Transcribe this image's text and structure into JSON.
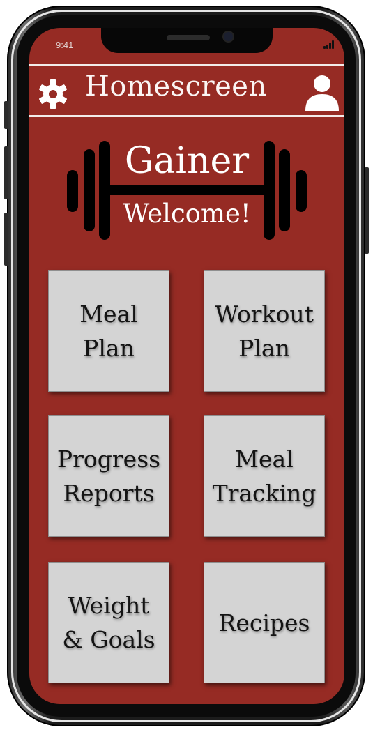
{
  "status_bar": {
    "time": "9:41"
  },
  "header": {
    "title": "Homescreen",
    "settings_icon": "gear-icon",
    "profile_icon": "user-icon"
  },
  "logo": {
    "app_name": "Gainer",
    "welcome": "Welcome!",
    "icon": "barbell-icon"
  },
  "tiles": [
    {
      "label": "Meal\nPlan"
    },
    {
      "label": "Workout\nPlan"
    },
    {
      "label": "Progress\nReports"
    },
    {
      "label": "Meal\nTracking"
    },
    {
      "label": "Weight\n& Goals"
    },
    {
      "label": "Recipes"
    }
  ],
  "colors": {
    "background": "#962b24",
    "tile": "#d4d4d4",
    "header_text": "#fbf5f4"
  }
}
